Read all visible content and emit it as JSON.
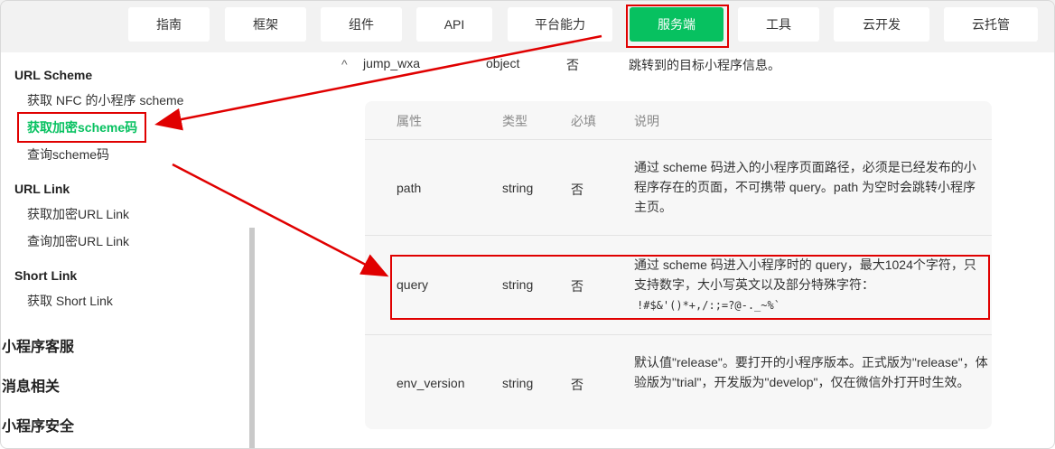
{
  "nav": {
    "items": [
      "指南",
      "框架",
      "组件",
      "API",
      "平台能力",
      "服务端",
      "工具",
      "云开发",
      "云托管"
    ],
    "active": "服务端"
  },
  "sidebar": {
    "url_scheme": {
      "heading": "URL Scheme",
      "items": [
        "获取 NFC 的小程序 scheme",
        "获取加密scheme码",
        "查询scheme码"
      ]
    },
    "url_link": {
      "heading": "URL Link",
      "items": [
        "获取加密URL Link",
        "查询加密URL Link"
      ]
    },
    "short_link": {
      "heading": "Short Link",
      "items": [
        "获取 Short Link"
      ]
    },
    "sections": [
      "小程序客服",
      "消息相关",
      "小程序安全"
    ]
  },
  "top_row": {
    "caret": "^",
    "name": "jump_wxa",
    "type": "object",
    "required": "否",
    "desc": "跳转到的目标小程序信息。"
  },
  "table": {
    "headers": [
      "属性",
      "类型",
      "必填",
      "说明"
    ],
    "rows": [
      {
        "name": "path",
        "type": "string",
        "required": "否",
        "desc": "通过 scheme 码进入的小程序页面路径，必须是已经发布的小程序存在的页面，不可携带 query。path 为空时会跳转小程序主页。"
      },
      {
        "name": "query",
        "type": "string",
        "required": "否",
        "desc": "通过 scheme 码进入小程序时的 query，最大1024个字符，只支持数字，大小写英文以及部分特殊字符：",
        "chars": "!#$&'()*+,/:;=?@-._~%`"
      },
      {
        "name": "env_version",
        "type": "string",
        "required": "否",
        "desc": "默认值\"release\"。要打开的小程序版本。正式版为\"release\"，体验版为\"trial\"，开发版为\"develop\"，仅在微信外打开时生效。"
      }
    ]
  },
  "colors": {
    "accent": "#07c160",
    "annotation": "#e00000",
    "topbar": "#f2f2f2",
    "table_bg": "#f7f7f7"
  }
}
